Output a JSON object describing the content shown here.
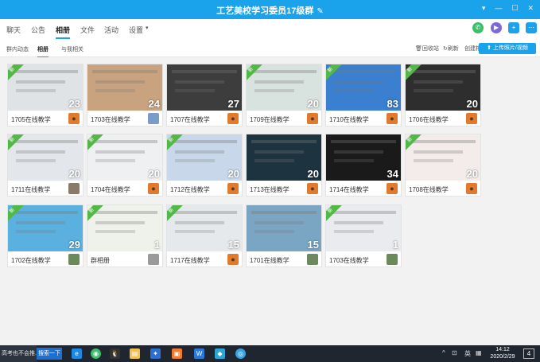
{
  "window": {
    "title": "工艺美校学习委员17级群",
    "controls": [
      "chevron-down-icon",
      "minimize-icon",
      "maximize-icon",
      "close-icon"
    ]
  },
  "tabs": [
    {
      "label": "聊天",
      "active": false
    },
    {
      "label": "公告",
      "active": false
    },
    {
      "label": "相册",
      "active": true
    },
    {
      "label": "文件",
      "active": false
    },
    {
      "label": "活动",
      "active": false
    },
    {
      "label": "设置",
      "active": false
    }
  ],
  "subtabs": [
    {
      "label": "群内动态",
      "active": false
    },
    {
      "label": "相册",
      "active": true
    },
    {
      "label": "与我相关",
      "active": false
    }
  ],
  "actions": {
    "recycle": "回收站",
    "refresh": "刷新",
    "create": "创建相册",
    "upload": "上传照片/视频"
  },
  "albums": [
    {
      "name": "1705在线教学",
      "count": "23",
      "new": true,
      "thumb_color": "#dfe3e6",
      "avatar": "bear",
      "avatar_color": "#e07a2e"
    },
    {
      "name": "1703在线教学",
      "count": "24",
      "new": false,
      "thumb_color": "#c9a37f",
      "avatar": "user",
      "avatar_color": "#7a9cc6"
    },
    {
      "name": "1707在线教学",
      "count": "27",
      "new": false,
      "thumb_color": "#3d3d3d",
      "avatar": "bear",
      "avatar_color": "#e07a2e"
    },
    {
      "name": "1709在线教学",
      "count": "20",
      "new": true,
      "thumb_color": "#d8e2de",
      "avatar": "bear",
      "avatar_color": "#e07a2e"
    },
    {
      "name": "1710在线教学",
      "count": "83",
      "new": true,
      "thumb_color": "#3a7fd0",
      "avatar": "bear",
      "avatar_color": "#e07a2e"
    },
    {
      "name": "1706在线教学",
      "count": "20",
      "new": true,
      "thumb_color": "#2e2e2e",
      "avatar": "bear",
      "avatar_color": "#e07a2e"
    },
    {
      "name": "1711在线教学",
      "count": "20",
      "new": true,
      "thumb_color": "#e3e6ea",
      "avatar": "user",
      "avatar_color": "#8a7a6a"
    },
    {
      "name": "1704在线教学",
      "count": "20",
      "new": true,
      "thumb_color": "#eef0f2",
      "avatar": "bear",
      "avatar_color": "#e07a2e"
    },
    {
      "name": "1712在线教学",
      "count": "20",
      "new": true,
      "thumb_color": "#c8d8ea",
      "avatar": "bear",
      "avatar_color": "#e07a2e"
    },
    {
      "name": "1713在线教学",
      "count": "20",
      "new": false,
      "thumb_color": "#1e3340",
      "avatar": "bear",
      "avatar_color": "#e07a2e"
    },
    {
      "name": "1714在线教学",
      "count": "34",
      "new": false,
      "thumb_color": "#1a1a1a",
      "avatar": "bear",
      "avatar_color": "#e07a2e"
    },
    {
      "name": "1708在线教学",
      "count": "20",
      "new": true,
      "thumb_color": "#f3eceb",
      "avatar": "bear",
      "avatar_color": "#e07a2e"
    },
    {
      "name": "1702在线教学",
      "count": "29",
      "new": true,
      "thumb_color": "#5ab1e0",
      "avatar": "user",
      "avatar_color": "#6a8a5a"
    },
    {
      "name": "群相册",
      "count": "1",
      "new": true,
      "thumb_color": "#eef2ea",
      "avatar": "user",
      "avatar_color": "#9a9a9a"
    },
    {
      "name": "1717在线教学",
      "count": "15",
      "new": true,
      "thumb_color": "#e6e9ec",
      "avatar": "bear",
      "avatar_color": "#e07a2e"
    },
    {
      "name": "1701在线教学",
      "count": "15",
      "new": false,
      "thumb_color": "#7aa6c4",
      "avatar": "user",
      "avatar_color": "#6a8a5a"
    },
    {
      "name": "1703在线教学",
      "count": "1",
      "new": true,
      "thumb_color": "#e9ebee",
      "avatar": "user",
      "avatar_color": "#6a8a5a"
    }
  ],
  "taskbar": {
    "search_text": "高考也不会推...",
    "search_button": "搜索一下",
    "tray_lang": "英",
    "time": "14:12",
    "date": "2020/2/29",
    "notify": "4",
    "bar_color": "#1f2630"
  }
}
